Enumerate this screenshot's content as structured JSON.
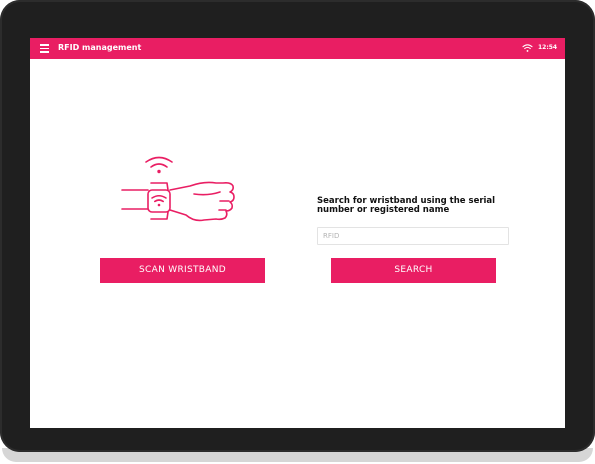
{
  "appbar": {
    "title": "RFID management",
    "time": "12:54",
    "menu_icon": "hamburger-menu-icon",
    "status_icon": "wifi-icon",
    "color": "#e91e63"
  },
  "main": {
    "illustration_icon": "wristband-scan-icon",
    "scan_button_label": "SCAN WRISTBAND",
    "search_label": "Search for wristband using the serial number or registered name",
    "search_placeholder": "RFID",
    "search_value": "",
    "search_button_label": "SEARCH"
  }
}
